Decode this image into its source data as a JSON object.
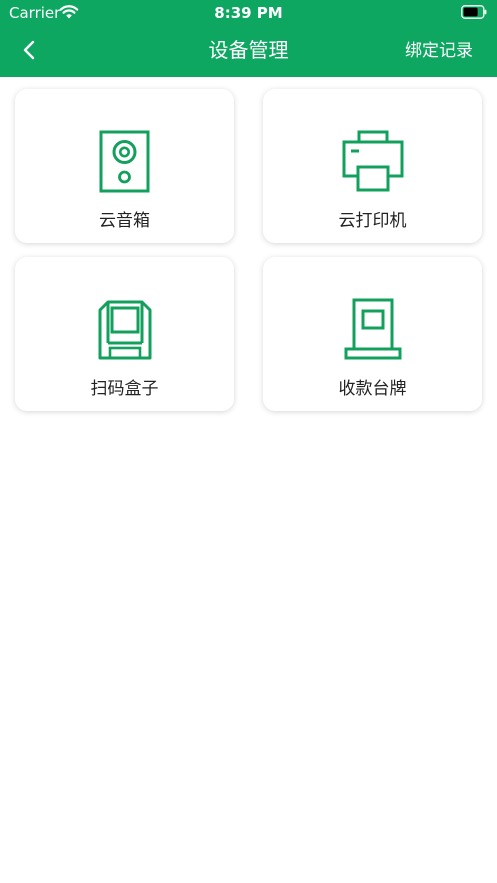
{
  "status_bar": {
    "carrier": "Carrier",
    "time": "8:39 PM"
  },
  "nav": {
    "title": "设备管理",
    "right_action": "绑定记录"
  },
  "colors": {
    "brand_green": "#0ea761",
    "icon_green": "#12a05c"
  },
  "devices": [
    {
      "label": "云音箱",
      "icon": "speaker-icon"
    },
    {
      "label": "云打印机",
      "icon": "printer-icon"
    },
    {
      "label": "扫码盒子",
      "icon": "scan-box-icon"
    },
    {
      "label": "收款台牌",
      "icon": "payment-stand-icon"
    }
  ]
}
